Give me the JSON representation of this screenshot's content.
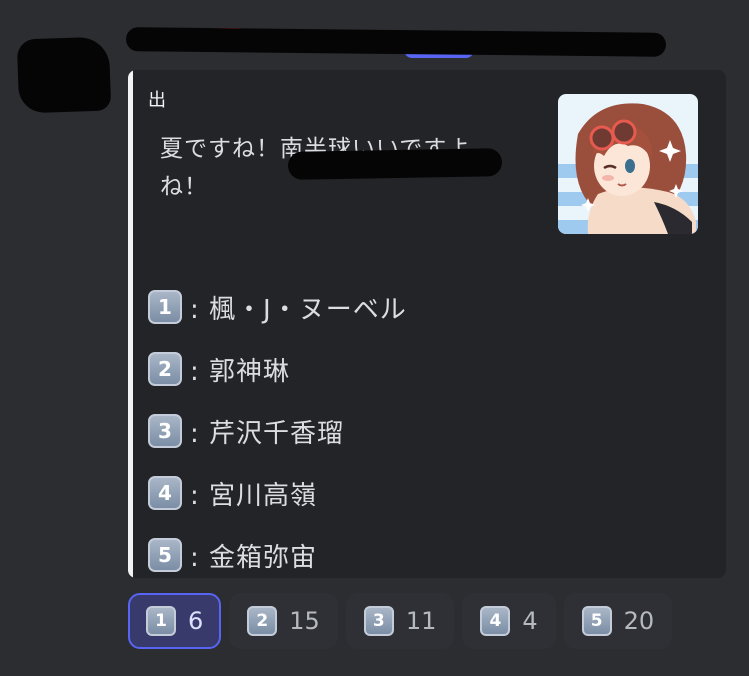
{
  "message": {
    "embed": {
      "author_visible_fragment": "出",
      "description_lines": [
        "夏ですね！南半球いいですよ",
        "ね！"
      ],
      "thumbnail_icon": "anime-character-avatar",
      "accent_bar_color": "#f2f3f5",
      "choices": [
        {
          "number": "1",
          "label": ": 楓・J・ヌーベル"
        },
        {
          "number": "2",
          "label": ": 郭神琳"
        },
        {
          "number": "3",
          "label": ": 芹沢千香瑠"
        },
        {
          "number": "4",
          "label": ": 宮川高嶺"
        },
        {
          "number": "5",
          "label": ": 金箱弥宙"
        }
      ]
    },
    "reactions": [
      {
        "emoji": "1",
        "count": "6",
        "selected": true
      },
      {
        "emoji": "2",
        "count": "15",
        "selected": false
      },
      {
        "emoji": "3",
        "count": "11",
        "selected": false
      },
      {
        "emoji": "4",
        "count": "4",
        "selected": false
      },
      {
        "emoji": "5",
        "count": "20",
        "selected": false
      }
    ]
  }
}
